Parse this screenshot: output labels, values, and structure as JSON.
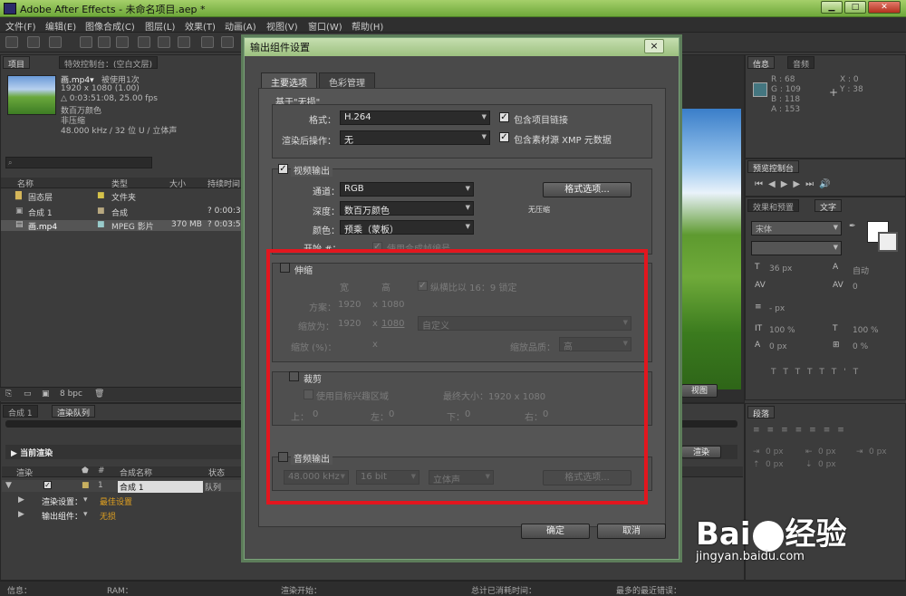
{
  "app": {
    "title": "Adobe After Effects - 未命名项目.aep *"
  },
  "menu": [
    "文件(F)",
    "编辑(E)",
    "图像合成(C)",
    "图层(L)",
    "效果(T)",
    "动画(A)",
    "视图(V)",
    "窗口(W)",
    "帮助(H)"
  ],
  "project_panel": {
    "tabs": [
      "项目",
      "特效控制台：(空白文层)"
    ],
    "file_name": "画.mp4▾",
    "used": "被使用1次",
    "info": [
      "1920 x 1080 (1.00)",
      "△ 0:03:51:08, 25.00 fps",
      "数百万颜色",
      "非压缩",
      "48.000 kHz / 32 位 U / 立体声"
    ],
    "columns": [
      "名称",
      "类型",
      "大小",
      "持续时间"
    ],
    "items": [
      {
        "name": "固态层",
        "type": "文件夹",
        "size": "",
        "dur": ""
      },
      {
        "name": "合成 1",
        "type": "合成",
        "size": "",
        "dur": "? 0:00:30"
      },
      {
        "name": "画.mp4",
        "type": "MPEG 影片",
        "size": "370 MB",
        "dur": "? 0:03:51"
      }
    ],
    "bpc": "8 bpc"
  },
  "render_queue": {
    "tabs": [
      "合成 1",
      "渲染队列"
    ],
    "current_render": "当前渲染",
    "columns": [
      "渲染",
      "#",
      "合成名称",
      "状态"
    ],
    "item": {
      "num": "1",
      "name": "合成 1",
      "status": "队列"
    },
    "render_settings_label": "渲染设置：",
    "render_settings_value": "最佳设置",
    "output_module_label": "输出组件：",
    "output_module_value": "无损",
    "render_button": "渲染"
  },
  "right_panels": {
    "info_tabs": [
      "信息",
      "音频"
    ],
    "info_values": [
      "R : 68",
      "G : 109",
      "B : 118",
      "A : 153",
      "X : 0",
      "Y : 38"
    ],
    "preview_tab": "预览控制台",
    "effects_tabs": [
      "效果和预置",
      "文字"
    ],
    "font_name": "宋体",
    "font_size": "36 px",
    "leading": "自动",
    "tracking_value": "0",
    "stroke": "- px",
    "scale_v": "100 %",
    "scale_h": "100 %",
    "baseline": "0 px",
    "tsume": "0 %",
    "para_tab": "段落",
    "para_values": [
      "0 px",
      "0 px",
      "0 px",
      "0 px",
      "0 px"
    ],
    "view_label": "视图"
  },
  "dialog": {
    "title": "输出组件设置",
    "close": "×",
    "tabs": [
      "主要选项",
      "色彩管理"
    ],
    "based_on": "基于\"无损\"",
    "format_label": "格式：",
    "format_value": "H.264",
    "post_label": "渲染后操作：",
    "post_value": "无",
    "include_link": "包含项目链接",
    "include_xmp": "包含素材源 XMP 元数据",
    "video_output": "视频输出",
    "channels_label": "通道：",
    "channels_value": "RGB",
    "depth_label": "深度：",
    "depth_value": "数百万颜色",
    "color_label": "颜色：",
    "color_value": "预乘（蒙板）",
    "format_options": "格式选项...",
    "uncompressed": "无压缩",
    "start_label": "开始 #：",
    "start_check": "使用合成帧编号",
    "stretch": "伸缩",
    "width_h": "宽",
    "height_h": "高",
    "lock_aspect": "纵横比以 16：9 锁定",
    "rendering_at_label": "方案：",
    "rendering_w": "1920",
    "rendering_x": "x",
    "rendering_h": "1080",
    "stretch_to_label": "缩放为：",
    "stretch_w": "1920",
    "stretch_h": "1080",
    "custom": "自定义",
    "stretch_pct_label": "缩放 (%)：",
    "stretch_pct_x": "x",
    "stretch_quality_label": "缩放品质：",
    "stretch_quality": "高",
    "crop": "裁剪",
    "use_roi": "使用目标兴趣区域",
    "final_size": "最终大小：1920 x 1080",
    "top": "上：",
    "top_v": "0",
    "left": "左：",
    "left_v": "0",
    "bottom": "下：",
    "bottom_v": "0",
    "right": "右：",
    "right_v": "0",
    "audio_output": "音频输出",
    "audio_rate": "48.000 kHz",
    "audio_bit": "16 bit",
    "audio_ch": "立体声",
    "audio_format_options": "格式选项...",
    "ok": "确定",
    "cancel": "取消"
  },
  "status": {
    "info": "信息：",
    "ram": "RAM：",
    "render_start": "渲染开始：",
    "total_time": "总计已消耗时间：",
    "recent_error": "最多的最近错误："
  },
  "watermark": {
    "brand_left": "Bai",
    "brand_right": "经验",
    "url": "jingyan.baidu.com"
  },
  "colors": {
    "accent_green": "#9cc07f",
    "highlight_red": "#e3161e",
    "value_orange": "#e0a020"
  }
}
